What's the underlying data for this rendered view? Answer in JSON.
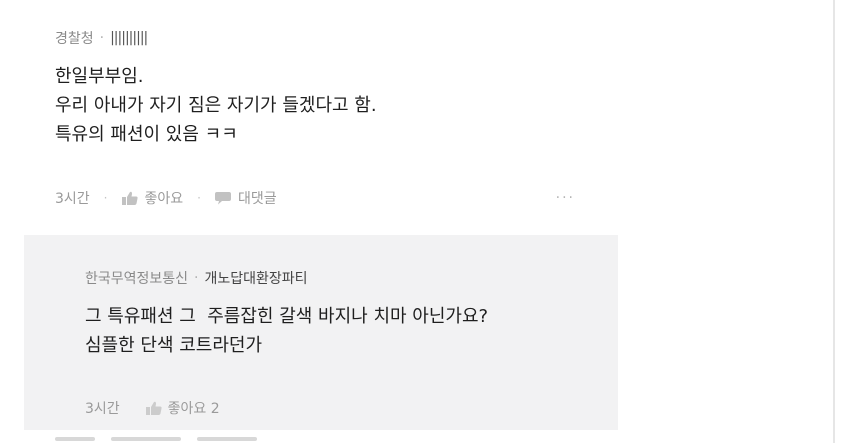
{
  "comment": {
    "author": "경찰청",
    "separator": "·",
    "handle": "||||||||||",
    "lines": [
      "한일부부임.",
      "우리 아내가 자기 짐은 자기가 들겠다고 함.",
      "특유의 패션이 있음 ㅋㅋ"
    ],
    "time": "3시간",
    "like_label": "좋아요",
    "reply_label": "대댓글",
    "more_label": "···"
  },
  "reply": {
    "author": "한국무역정보통신",
    "separator": "·",
    "handle": "개노답대환장파티",
    "lines": [
      "그 특유패션 그  주름잡힌 갈색 바지나 치마 아닌가요?",
      "심플한 단색 코트라던가"
    ],
    "time": "3시간",
    "like_label": "좋아요 2"
  },
  "colors": {
    "background": "#ffffff",
    "reply_background": "#f2f2f3",
    "text": "#1f1f1f",
    "meta_text": "#8a8a8a",
    "icon": "#c2c2c2"
  },
  "icons": {
    "like": "thumbs-up-icon",
    "reply": "speech-bubble-icon"
  }
}
